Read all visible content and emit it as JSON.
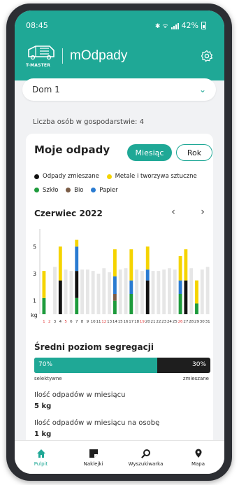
{
  "status": {
    "time": "08:45",
    "icons": "✱ ᯤ",
    "battery": "42%"
  },
  "header": {
    "logo_text": "T-MASTER",
    "app_title": "mOdpady",
    "settings_icon": "gear-icon"
  },
  "household_select": {
    "value": "Dom 1"
  },
  "persons": "Liczba osób w gospodarstwie: 4",
  "card": {
    "title": "Moje odpady",
    "period_buttons": {
      "month": "Miesiąc",
      "year": "Rok"
    },
    "legend": [
      {
        "label": "Odpady zmieszane",
        "color": "#111111"
      },
      {
        "label": "Metale i tworzywa sztuczne",
        "color": "#f5d400"
      },
      {
        "label": "Szkło",
        "color": "#1e9b3c"
      },
      {
        "label": "Bio",
        "color": "#7a5c46"
      },
      {
        "label": "Papier",
        "color": "#2a7bd1"
      }
    ],
    "month_label": "Czerwiec 2022",
    "nav_prev": "‹",
    "nav_next": "›"
  },
  "chart_data": {
    "type": "bar",
    "stacked": true,
    "x": [
      1,
      2,
      3,
      4,
      5,
      6,
      7,
      8,
      9,
      10,
      11,
      12,
      13,
      14,
      15,
      16,
      17,
      18,
      19,
      20,
      21,
      22,
      23,
      24,
      25,
      26,
      27,
      28,
      29,
      30,
      31
    ],
    "highlighted_x": [
      1,
      2,
      5,
      12,
      19,
      26
    ],
    "ylabel": "kg",
    "yticks": [
      1,
      3,
      5
    ],
    "ylim": [
      0,
      6
    ],
    "series": [
      {
        "name": "Szkło",
        "color": "#1e9b3c",
        "values": [
          1.2,
          0,
          0,
          0,
          0,
          0,
          1.2,
          0,
          0,
          0,
          0,
          0,
          0,
          1,
          0,
          0,
          1.5,
          0,
          0,
          0,
          0,
          0,
          0,
          0,
          0,
          1.5,
          0,
          0,
          0.8,
          0,
          0
        ]
      },
      {
        "name": "Odpady zmieszane",
        "color": "#111111",
        "values": [
          0,
          0,
          0,
          2.5,
          0,
          0,
          2,
          0,
          0,
          0,
          0,
          0,
          0,
          0,
          0,
          0,
          0,
          0,
          0,
          2.5,
          0,
          0,
          0,
          0,
          0,
          0,
          2.5,
          0,
          0,
          0,
          0
        ]
      },
      {
        "name": "Bio",
        "color": "#7a5c46",
        "values": [
          0,
          0,
          0,
          0,
          0,
          0,
          0,
          0,
          0,
          0,
          0,
          0,
          0,
          0.5,
          0,
          0,
          0,
          0,
          0,
          0,
          0,
          0,
          0,
          0,
          0,
          0,
          0,
          0,
          0,
          0,
          0
        ]
      },
      {
        "name": "Papier",
        "color": "#2a7bd1",
        "values": [
          0,
          0,
          0,
          0,
          0,
          0,
          1.8,
          0,
          0,
          0,
          0,
          0,
          0,
          1.3,
          0,
          0,
          1,
          0,
          0,
          0.8,
          0,
          0,
          0,
          0,
          0,
          1,
          0,
          0,
          0,
          0,
          0
        ]
      },
      {
        "name": "Metale i tworzywa sztuczne",
        "color": "#f5d400",
        "values": [
          2,
          0,
          0,
          2.5,
          0,
          0,
          0.5,
          0,
          0,
          0,
          0,
          0,
          0,
          2,
          0,
          0,
          2.3,
          0,
          0,
          1.7,
          0,
          0,
          0,
          0,
          0,
          1.8,
          2.3,
          0,
          1.7,
          0,
          0
        ]
      }
    ],
    "average_series": {
      "color": "#e6e6e6",
      "values": [
        0,
        0,
        3.5,
        0,
        3.3,
        3.2,
        0,
        3.3,
        3.3,
        3.2,
        3,
        3.4,
        3.1,
        0,
        3.3,
        3.4,
        0,
        3.3,
        3.2,
        0,
        3.2,
        3.2,
        3.3,
        3.4,
        3.3,
        0,
        0,
        3.4,
        0,
        3.3,
        3.5
      ]
    }
  },
  "segregation": {
    "title": "Średni poziom segregacji",
    "selective_percent": 70,
    "selective_text": "70%",
    "mixed_text": "30%",
    "selective_label": "selektywne",
    "mixed_label": "zmieszane"
  },
  "stats": [
    {
      "label": "Ilość odpadów w miesiącu",
      "value": "5 kg"
    },
    {
      "label": "Ilość odpadów w miesiącu na osobę",
      "value": "1 kg"
    }
  ],
  "bottom_nav": [
    {
      "label": "Pulpit",
      "icon": "home-icon",
      "active": true
    },
    {
      "label": "Naklejki",
      "icon": "sticker-icon",
      "active": false
    },
    {
      "label": "Wyszukiwarka",
      "icon": "search-icon",
      "active": false
    },
    {
      "label": "Mapa",
      "icon": "map-pin-icon",
      "active": false
    }
  ],
  "colors": {
    "accent": "#1fa896",
    "dark": "#1e1e1e",
    "highlight_day": "#e23b3b"
  }
}
